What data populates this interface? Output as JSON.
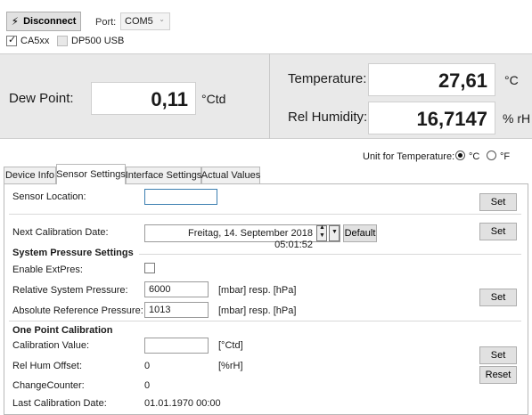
{
  "toolbar": {
    "disconnect_label": "Disconnect",
    "port_label": "Port:",
    "port_value": "COM5",
    "ca5xx_label": "CA5xx",
    "ca5xx_checked": true,
    "dp500_label": "DP500 USB",
    "dp500_checked": false
  },
  "readings": {
    "dew_point_label": "Dew Point:",
    "dew_point_value": "0,11",
    "dew_point_unit": "°Ctd",
    "temperature_label": "Temperature:",
    "temperature_value": "27,61",
    "temperature_unit": "°C",
    "humidity_label": "Rel Humidity:",
    "humidity_value": "16,7147",
    "humidity_unit": "% rH"
  },
  "unit_selector": {
    "label": "Unit for Temperature:",
    "option_c": "°C",
    "option_f": "°F",
    "selected": "°C"
  },
  "tabs": [
    {
      "label": "Device Info"
    },
    {
      "label": "Sensor Settings"
    },
    {
      "label": "Interface Settings"
    },
    {
      "label": "Actual Values"
    }
  ],
  "active_tab": "Sensor Settings",
  "sensor_settings": {
    "sensor_location_label": "Sensor Location:",
    "sensor_location_value": "",
    "set_label": "Set",
    "next_cal_label": "Next Calibration Date:",
    "next_cal_value": "Freitag, 14. September 2018 05:01:52",
    "default_label": "Default",
    "system_pressure_heading": "System Pressure Settings",
    "enable_extpres_label": "Enable ExtPres:",
    "enable_extpres_checked": false,
    "rel_pressure_label": "Relative System Pressure:",
    "rel_pressure_value": "6000",
    "abs_pressure_label": "Absolute Reference Pressure:",
    "abs_pressure_value": "1013",
    "pressure_unit": "[mbar] resp. [hPa]",
    "one_point_heading": "One Point Calibration",
    "cal_value_label": "Calibration Value:",
    "cal_value_value": "",
    "cal_value_unit": "[°Ctd]",
    "rel_hum_offset_label": "Rel Hum Offset:",
    "rel_hum_offset_value": "0",
    "rel_hum_offset_unit": "[%rH]",
    "change_counter_label": "ChangeCounter:",
    "change_counter_value": "0",
    "last_cal_label": "Last Calibration Date:",
    "last_cal_value": "01.01.1970 00:00",
    "reset_label": "Reset"
  }
}
